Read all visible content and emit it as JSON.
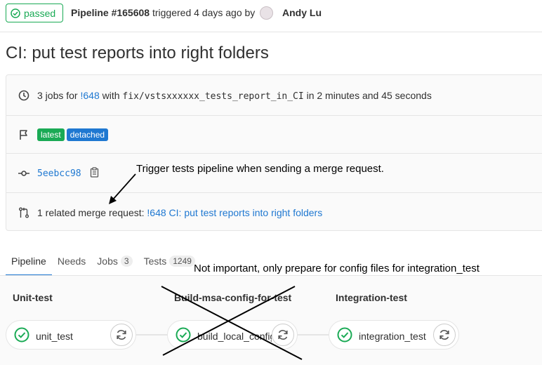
{
  "header": {
    "status_label": "passed",
    "pipeline_id": "Pipeline #165608",
    "triggered_text": "triggered 4 days ago by",
    "author": "Andy Lu"
  },
  "title": "CI: put test reports into right folders",
  "info": {
    "jobs_prefix": "3 jobs for",
    "mr_ref": "!648",
    "with_text": "with",
    "branch": "fix/vstsxxxxxx_tests_report_in_CI",
    "duration_text": "in 2 minutes and 45 seconds",
    "labels": [
      "latest",
      "detached"
    ],
    "commit_sha": "5eebcc98",
    "related_prefix": "1 related merge request:",
    "related_link": "!648 CI: put test reports into right folders"
  },
  "annotations": {
    "note1": "Trigger tests pipeline when sending a merge request.",
    "note2": "Not important, only prepare for config files for integration_test"
  },
  "tabs": [
    {
      "label": "Pipeline",
      "count": ""
    },
    {
      "label": "Needs",
      "count": ""
    },
    {
      "label": "Jobs",
      "count": "3"
    },
    {
      "label": "Tests",
      "count": "1249"
    }
  ],
  "stages": [
    {
      "title": "Unit-test",
      "job": "unit_test"
    },
    {
      "title": "Build-msa-config-for-test",
      "job": "build_local_config"
    },
    {
      "title": "Integration-test",
      "job": "integration_test"
    }
  ],
  "colors": {
    "success": "#1aaa55",
    "link": "#1f78d1"
  },
  "icons": [
    "check-circle-icon",
    "clock-icon",
    "flag-icon",
    "commit-icon",
    "clipboard-icon",
    "merge-request-icon",
    "retry-icon"
  ]
}
